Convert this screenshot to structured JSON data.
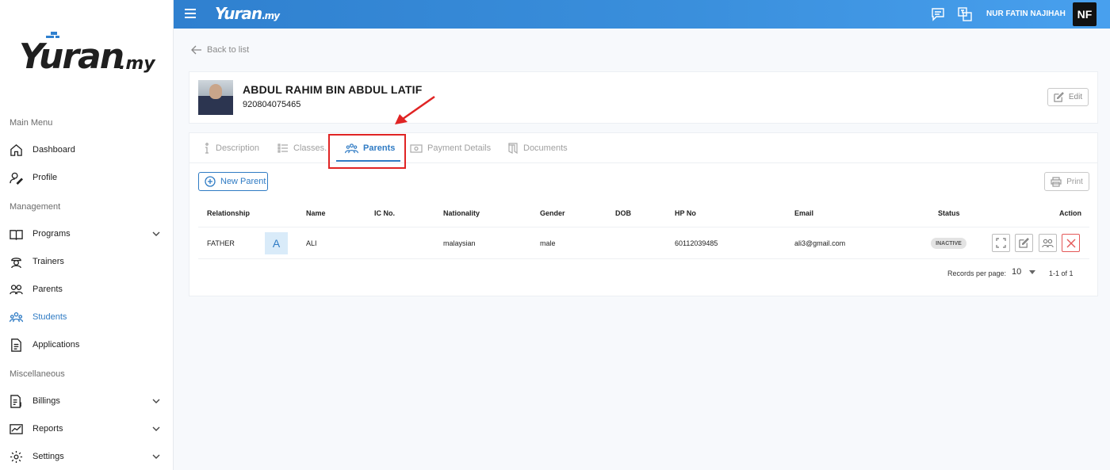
{
  "brand": {
    "logo_main": "Yuran",
    "logo_suffix": ".my",
    "top_logo_main": "Yuran",
    "top_logo_suffix": ".my"
  },
  "sidebar": {
    "sections": [
      "Main Menu",
      "Management",
      "Miscellaneous"
    ],
    "items": [
      {
        "label": "Dashboard",
        "icon": "home-icon"
      },
      {
        "label": "Profile",
        "icon": "user-edit-icon"
      },
      {
        "label": "Programs",
        "icon": "book-icon",
        "expandable": true
      },
      {
        "label": "Trainers",
        "icon": "trainer-icon"
      },
      {
        "label": "Parents",
        "icon": "parents-icon"
      },
      {
        "label": "Students",
        "icon": "students-icon",
        "active": true
      },
      {
        "label": "Applications",
        "icon": "document-icon"
      },
      {
        "label": "Billings",
        "icon": "billing-icon",
        "expandable": true
      },
      {
        "label": "Reports",
        "icon": "chart-icon",
        "expandable": true
      },
      {
        "label": "Settings",
        "icon": "gear-icon",
        "expandable": true
      }
    ]
  },
  "header": {
    "user_name": "NUR FATIN NAJIHAH",
    "user_initials": "NF"
  },
  "back_label": "Back to list",
  "student": {
    "name": "ABDUL RAHIM BIN ABDUL LATIF",
    "ic": "920804075465",
    "edit_label": "Edit"
  },
  "tabs": [
    {
      "label": "Description",
      "icon": "info-icon"
    },
    {
      "label": "Classes.",
      "icon": "list-icon"
    },
    {
      "label": "Parents",
      "icon": "parents-icon",
      "active": true
    },
    {
      "label": "Payment Details",
      "icon": "money-icon"
    },
    {
      "label": "Documents",
      "icon": "folder-icon"
    }
  ],
  "toolbar": {
    "new_parent_label": "New Parent",
    "print_label": "Print"
  },
  "table": {
    "columns": [
      "Relationship",
      "Name",
      "IC No.",
      "Nationality",
      "Gender",
      "DOB",
      "HP No",
      "Email",
      "Status",
      "Action"
    ],
    "rows": [
      {
        "relationship": "FATHER",
        "avatar_letter": "A",
        "name": "ALI",
        "ic": "",
        "nationality": "malaysian",
        "gender": "male",
        "dob": "",
        "hp": "60112039485",
        "email": "ali3@gmail.com",
        "status": "INACTIVE"
      }
    ]
  },
  "pagination": {
    "records_label": "Records per page:",
    "per_page": "10",
    "range": "1-1 of 1"
  },
  "colors": {
    "primary": "#2f7bc4",
    "topbar": "#3a8fdc",
    "highlight": "#e02424",
    "delete": "#e45858"
  }
}
